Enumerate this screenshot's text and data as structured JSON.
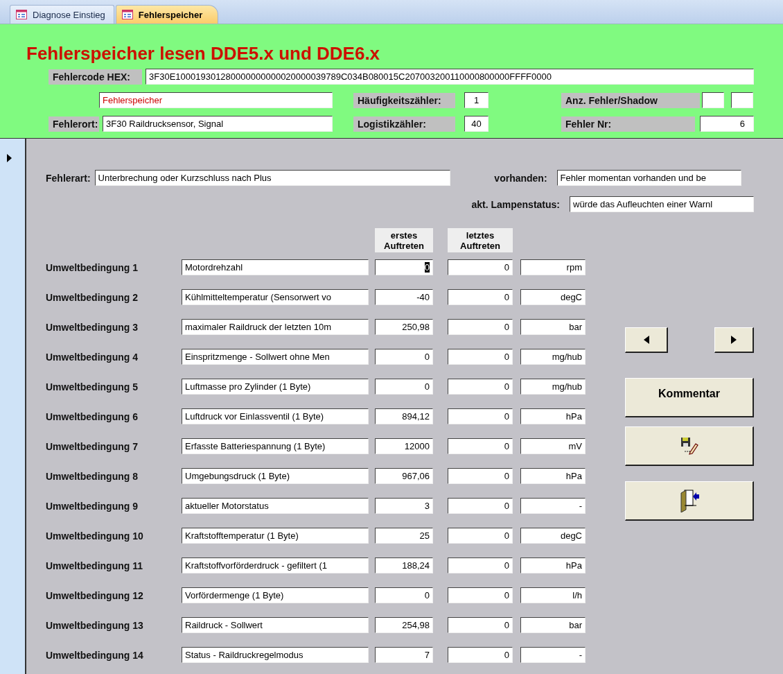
{
  "tabs": [
    {
      "label": "Diagnose Einstieg",
      "selected": false
    },
    {
      "label": "Fehlerspeicher",
      "selected": true
    }
  ],
  "header": {
    "title": "Fehlerspeicher lesen DDE5.x und DDE6.x",
    "hex": {
      "label": "Fehlercode HEX:",
      "value": "3F30E100019301280000000000020000039789C034B080015C207003200110000800000FFFF0000"
    },
    "memory": {
      "value": "Fehlerspeicher"
    },
    "frequency": {
      "label": "Häufigkeitszähler:",
      "value": "1"
    },
    "shadow": {
      "label": "Anz. Fehler/Shadow"
    },
    "location": {
      "label": "Fehlerort:",
      "value": "3F30 Raildrucksensor, Signal"
    },
    "logistics": {
      "label": "Logistikzähler:",
      "value": "40"
    },
    "number": {
      "label": "Fehler Nr:",
      "value": "6"
    }
  },
  "details": {
    "type": {
      "label": "Fehlerart:",
      "value": "Unterbrechung oder Kurzschluss nach Plus"
    },
    "present": {
      "label": "vorhanden:",
      "value": "Fehler momentan vorhanden und be"
    },
    "lamp": {
      "label": "akt. Lampenstatus:",
      "value": "würde das Aufleuchten einer Warnl"
    }
  },
  "table": {
    "columns": [
      "erstes Auftreten",
      "letztes Auftreten"
    ],
    "rows": [
      {
        "label": "Umweltbedingung 1",
        "description": "Motordrehzahl",
        "first": "0",
        "last": "0",
        "unit": "rpm",
        "focused": true
      },
      {
        "label": "Umweltbedingung 2",
        "description": "Kühlmitteltemperatur (Sensorwert vo",
        "first": "-40",
        "last": "0",
        "unit": "degC",
        "focused": false
      },
      {
        "label": "Umweltbedingung 3",
        "description": "maximaler Raildruck der letzten 10m",
        "first": "250,98",
        "last": "0",
        "unit": "bar",
        "focused": false
      },
      {
        "label": "Umweltbedingung 4",
        "description": "Einspritzmenge - Sollwert ohne Men",
        "first": "0",
        "last": "0",
        "unit": "mg/hub",
        "focused": false
      },
      {
        "label": "Umweltbedingung 5",
        "description": "Luftmasse pro Zylinder (1 Byte)",
        "first": "0",
        "last": "0",
        "unit": "mg/hub",
        "focused": false
      },
      {
        "label": "Umweltbedingung 6",
        "description": "Luftdruck vor Einlassventil (1 Byte)",
        "first": "894,12",
        "last": "0",
        "unit": "hPa",
        "focused": false
      },
      {
        "label": "Umweltbedingung 7",
        "description": "Erfasste Batteriespannung (1 Byte)",
        "first": "12000",
        "last": "0",
        "unit": "mV",
        "focused": false
      },
      {
        "label": "Umweltbedingung 8",
        "description": "Umgebungsdruck (1 Byte)",
        "first": "967,06",
        "last": "0",
        "unit": "hPa",
        "focused": false
      },
      {
        "label": "Umweltbedingung 9",
        "description": "aktueller Motorstatus",
        "first": "3",
        "last": "0",
        "unit": "-",
        "focused": false
      },
      {
        "label": "Umweltbedingung 10",
        "description": "Kraftstofftemperatur (1 Byte)",
        "first": "25",
        "last": "0",
        "unit": "degC",
        "focused": false
      },
      {
        "label": "Umweltbedingung 11",
        "description": "Kraftstoffvorförderdruck - gefiltert (1",
        "first": "188,24",
        "last": "0",
        "unit": "hPa",
        "focused": false
      },
      {
        "label": "Umweltbedingung 12",
        "description": "Vorfördermenge (1 Byte)",
        "first": "0",
        "last": "0",
        "unit": "l/h",
        "focused": false
      },
      {
        "label": "Umweltbedingung 13",
        "description": "Raildruck - Sollwert",
        "first": "254,98",
        "last": "0",
        "unit": "bar",
        "focused": false
      },
      {
        "label": "Umweltbedingung 14",
        "description": "Status - Raildruckregelmodus",
        "first": "7",
        "last": "0",
        "unit": "-",
        "focused": false
      }
    ]
  },
  "buttons": [
    {
      "kind": "nav"
    },
    {
      "kind": "text",
      "label": "Kommentar"
    },
    {
      "kind": "save"
    },
    {
      "kind": "exit"
    }
  ]
}
